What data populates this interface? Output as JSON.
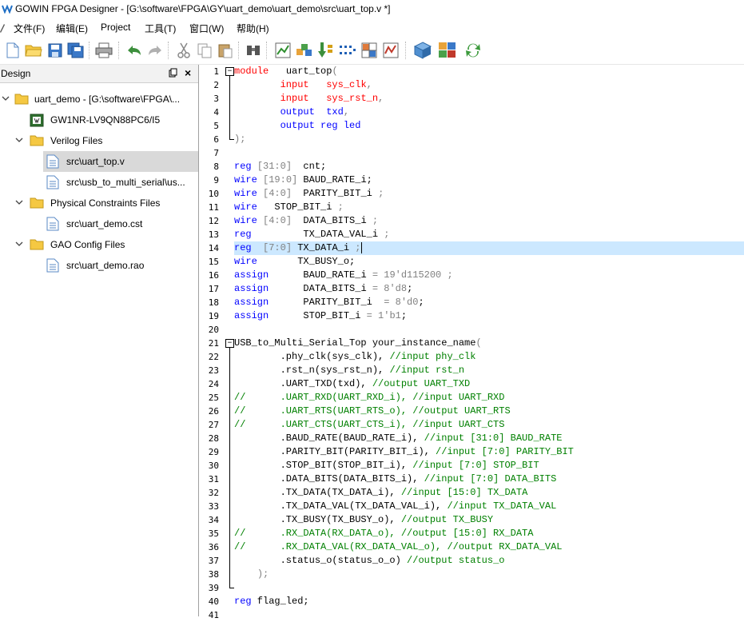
{
  "window": {
    "title": "GOWIN FPGA Designer - [G:\\software\\FPGA\\GY\\uart_demo\\uart_demo\\src\\uart_top.v *]"
  },
  "menu": {
    "items": [
      "文件(F)",
      "编辑(E)",
      "Project",
      "工具(T)",
      "窗口(W)",
      "帮助(H)"
    ]
  },
  "toolbar": {
    "buttons": [
      "new-file-icon",
      "open-folder-icon",
      "save-icon",
      "save-all-icon",
      "print-icon",
      "undo-icon",
      "redo-icon",
      "cut-icon",
      "copy-icon",
      "paste-icon",
      "find-icon",
      "synthesize-icon",
      "place-route-icon",
      "program-icon",
      "pin-planner-icon",
      "timing-constraints-icon",
      "gao-icon",
      "ip-core-icon",
      "floorplan-icon",
      "refresh-icon"
    ]
  },
  "design_panel": {
    "title": "Design",
    "items": [
      {
        "label": "uart_demo - [G:\\software\\FPGA\\...",
        "icon": "project-icon"
      },
      {
        "label": "GW1NR-LV9QN88PC6/I5",
        "icon": "chip-icon"
      },
      {
        "label": "Verilog Files",
        "icon": "folder-icon"
      },
      {
        "label": "src\\uart_top.v",
        "icon": "file-icon"
      },
      {
        "label": "src\\usb_to_multi_serial\\us...",
        "icon": "file-icon"
      },
      {
        "label": "Physical Constraints Files",
        "icon": "folder-icon"
      },
      {
        "label": "src\\uart_demo.cst",
        "icon": "file-icon"
      },
      {
        "label": "GAO Config Files",
        "icon": "folder-icon"
      },
      {
        "label": "src\\uart_demo.rao",
        "icon": "file-icon"
      }
    ]
  },
  "editor": {
    "selected_line": 14,
    "lines": [
      {
        "n": "1",
        "segs": [
          [
            "kw",
            "module"
          ],
          [
            "tx",
            "   uart_top"
          ],
          [
            "pc",
            "("
          ]
        ]
      },
      {
        "n": "2",
        "segs": [
          [
            "tx",
            "        "
          ],
          [
            "kw",
            "input"
          ],
          [
            "tx",
            "   "
          ],
          [
            "kw",
            "sys_clk"
          ],
          [
            "pc",
            ","
          ]
        ]
      },
      {
        "n": "3",
        "segs": [
          [
            "tx",
            "        "
          ],
          [
            "kw",
            "input"
          ],
          [
            "tx",
            "   "
          ],
          [
            "kw",
            "sys_rst_n"
          ],
          [
            "pc",
            ","
          ]
        ]
      },
      {
        "n": "4",
        "segs": [
          [
            "tx",
            "        "
          ],
          [
            "bl",
            "output"
          ],
          [
            "tx",
            "  "
          ],
          [
            "bl",
            "txd"
          ],
          [
            "pc",
            ","
          ]
        ]
      },
      {
        "n": "5",
        "segs": [
          [
            "tx",
            "        "
          ],
          [
            "bl",
            "output reg led"
          ]
        ]
      },
      {
        "n": "6",
        "segs": [
          [
            "pc",
            ");"
          ]
        ]
      },
      {
        "n": "7",
        "segs": []
      },
      {
        "n": "8",
        "segs": [
          [
            "bl",
            "reg"
          ],
          [
            "tx",
            " "
          ],
          [
            "pc",
            "[31:0]"
          ],
          [
            "tx",
            "  cnt;"
          ]
        ]
      },
      {
        "n": "9",
        "segs": [
          [
            "bl",
            "wire"
          ],
          [
            "tx",
            " "
          ],
          [
            "pc",
            "[19:0]"
          ],
          [
            "tx",
            " BAUD_RATE_i;"
          ]
        ]
      },
      {
        "n": "10",
        "segs": [
          [
            "bl",
            "wire"
          ],
          [
            "tx",
            " "
          ],
          [
            "pc",
            "[4:0]"
          ],
          [
            "tx",
            "  PARITY_BIT_i "
          ],
          [
            "pc",
            ";"
          ]
        ]
      },
      {
        "n": "11",
        "segs": [
          [
            "bl",
            "wire"
          ],
          [
            "tx",
            "   STOP_BIT_i "
          ],
          [
            "pc",
            ";"
          ]
        ]
      },
      {
        "n": "12",
        "segs": [
          [
            "bl",
            "wire"
          ],
          [
            "tx",
            " "
          ],
          [
            "pc",
            "[4:0]"
          ],
          [
            "tx",
            "  DATA_BITS_i "
          ],
          [
            "pc",
            ";"
          ]
        ]
      },
      {
        "n": "13",
        "segs": [
          [
            "bl",
            "reg"
          ],
          [
            "tx",
            "         TX_DATA_VAL_i "
          ],
          [
            "pc",
            ";"
          ]
        ]
      },
      {
        "n": "14",
        "segs": [
          [
            "bl",
            "reg"
          ],
          [
            "tx",
            "  "
          ],
          [
            "pc",
            "[7:0]"
          ],
          [
            "tx",
            " TX_DATA_i "
          ],
          [
            "pc",
            ";"
          ]
        ]
      },
      {
        "n": "15",
        "segs": [
          [
            "bl",
            "wire"
          ],
          [
            "tx",
            "       TX_BUSY_o;"
          ]
        ]
      },
      {
        "n": "16",
        "segs": [
          [
            "bl",
            "assign"
          ],
          [
            "tx",
            "      BAUD_RATE_i "
          ],
          [
            "pc",
            "="
          ],
          [
            "tx",
            " "
          ],
          [
            "pc",
            "19'd115200 ;"
          ]
        ]
      },
      {
        "n": "17",
        "segs": [
          [
            "bl",
            "assign"
          ],
          [
            "tx",
            "      DATA_BITS_i "
          ],
          [
            "pc",
            "="
          ],
          [
            "tx",
            " "
          ],
          [
            "pc",
            "8'd8"
          ],
          [
            "tx",
            ";"
          ]
        ]
      },
      {
        "n": "18",
        "segs": [
          [
            "bl",
            "assign"
          ],
          [
            "tx",
            "      PARITY_BIT_i  "
          ],
          [
            "pc",
            "="
          ],
          [
            "tx",
            " "
          ],
          [
            "pc",
            "8'd0"
          ],
          [
            "tx",
            ";"
          ]
        ]
      },
      {
        "n": "19",
        "segs": [
          [
            "bl",
            "assign"
          ],
          [
            "tx",
            "      STOP_BIT_i "
          ],
          [
            "pc",
            "="
          ],
          [
            "tx",
            " "
          ],
          [
            "pc",
            "1'b1"
          ],
          [
            "tx",
            ";"
          ]
        ]
      },
      {
        "n": "20",
        "segs": []
      },
      {
        "n": "21",
        "segs": [
          [
            "tx",
            "USB_to_Multi_Serial_Top your_instance_name"
          ],
          [
            "pc",
            "("
          ]
        ]
      },
      {
        "n": "22",
        "segs": [
          [
            "tx",
            "        .phy_clk(sys_clk), "
          ],
          [
            "cm",
            "//input phy_clk"
          ]
        ]
      },
      {
        "n": "23",
        "segs": [
          [
            "tx",
            "        .rst_n(sys_rst_n), "
          ],
          [
            "cm",
            "//input rst_n"
          ]
        ]
      },
      {
        "n": "24",
        "segs": [
          [
            "tx",
            "        .UART_TXD(txd), "
          ],
          [
            "cm",
            "//output UART_TXD"
          ]
        ]
      },
      {
        "n": "25",
        "segs": [
          [
            "cm",
            "//      .UART_RXD(UART_RXD_i), //input UART_RXD"
          ]
        ]
      },
      {
        "n": "26",
        "segs": [
          [
            "cm",
            "//      .UART_RTS(UART_RTS_o), //output UART_RTS"
          ]
        ]
      },
      {
        "n": "27",
        "segs": [
          [
            "cm",
            "//      .UART_CTS(UART_CTS_i), //input UART_CTS"
          ]
        ]
      },
      {
        "n": "28",
        "segs": [
          [
            "tx",
            "        .BAUD_RATE(BAUD_RATE_i), "
          ],
          [
            "cm",
            "//input [31:0] BAUD_RATE"
          ]
        ]
      },
      {
        "n": "29",
        "segs": [
          [
            "tx",
            "        .PARITY_BIT(PARITY_BIT_i), "
          ],
          [
            "cm",
            "//input [7:0] PARITY_BIT"
          ]
        ]
      },
      {
        "n": "30",
        "segs": [
          [
            "tx",
            "        .STOP_BIT(STOP_BIT_i), "
          ],
          [
            "cm",
            "//input [7:0] STOP_BIT"
          ]
        ]
      },
      {
        "n": "31",
        "segs": [
          [
            "tx",
            "        .DATA_BITS(DATA_BITS_i), "
          ],
          [
            "cm",
            "//input [7:0] DATA_BITS"
          ]
        ]
      },
      {
        "n": "32",
        "segs": [
          [
            "tx",
            "        .TX_DATA(TX_DATA_i), "
          ],
          [
            "cm",
            "//input [15:0] TX_DATA"
          ]
        ]
      },
      {
        "n": "33",
        "segs": [
          [
            "tx",
            "        .TX_DATA_VAL(TX_DATA_VAL_i), "
          ],
          [
            "cm",
            "//input TX_DATA_VAL"
          ]
        ]
      },
      {
        "n": "34",
        "segs": [
          [
            "tx",
            "        .TX_BUSY(TX_BUSY_o), "
          ],
          [
            "cm",
            "//output TX_BUSY"
          ]
        ]
      },
      {
        "n": "35",
        "segs": [
          [
            "cm",
            "//      .RX_DATA(RX_DATA_o), //output [15:0] RX_DATA"
          ]
        ]
      },
      {
        "n": "36",
        "segs": [
          [
            "cm",
            "//      .RX_DATA_VAL(RX_DATA_VAL_o), //output RX_DATA_VAL"
          ]
        ]
      },
      {
        "n": "37",
        "segs": [
          [
            "tx",
            "        .status_o(status_o_o) "
          ],
          [
            "cm",
            "//output status_o"
          ]
        ]
      },
      {
        "n": "38",
        "segs": [
          [
            "tx",
            "    "
          ],
          [
            "pc",
            ");"
          ]
        ]
      },
      {
        "n": "39",
        "segs": []
      },
      {
        "n": "40",
        "segs": [
          [
            "bl",
            "reg"
          ],
          [
            "tx",
            " flag_led;"
          ]
        ]
      },
      {
        "n": "41",
        "segs": []
      }
    ]
  }
}
